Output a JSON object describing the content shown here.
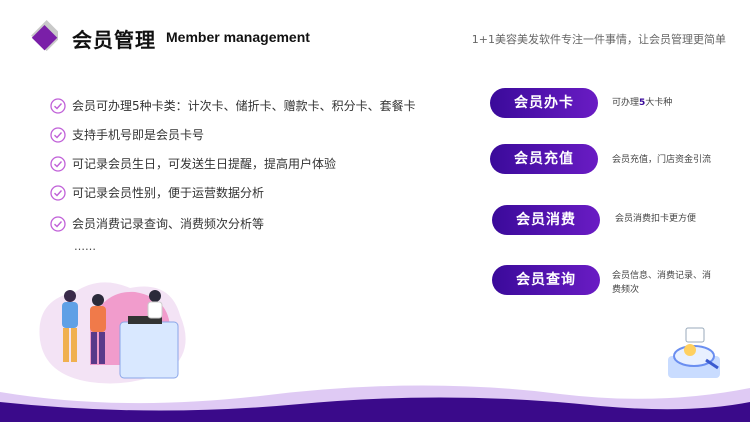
{
  "header": {
    "title_cn": "会员管理",
    "title_en": "Member management",
    "tagline": "1+1美容美发软件专注一件事情，让会员管理更简单"
  },
  "features": [
    "会员可办理5种卡类：计次卡、储折卡、赠款卡、积分卡、套餐卡",
    "支持手机号即是会员卡号",
    "可记录会员生日，可发送生日提醒，提高用户体验",
    "可记录会员性别，便于运营数据分析",
    "会员消费记录查询、消费频次分析等"
  ],
  "ellipsis": "……",
  "cards": [
    {
      "label": "会员办卡",
      "desc_pre": "可办理",
      "desc_num": "5",
      "desc_post": "大卡种"
    },
    {
      "label": "会员充值",
      "desc": "会员充值，门店资金引流"
    },
    {
      "label": "会员消费",
      "desc": "会员消费扣卡更方便"
    },
    {
      "label": "会员查询",
      "desc_line1": "会员信息、消费记录、消",
      "desc_line2": "费频次"
    }
  ],
  "colors": {
    "accent": "#4a12b0",
    "check": "#c060d8"
  },
  "icons": [
    "diamond-logo-icon",
    "check-circle-icon",
    "people-illustration",
    "magnifier-gadget-icon"
  ]
}
